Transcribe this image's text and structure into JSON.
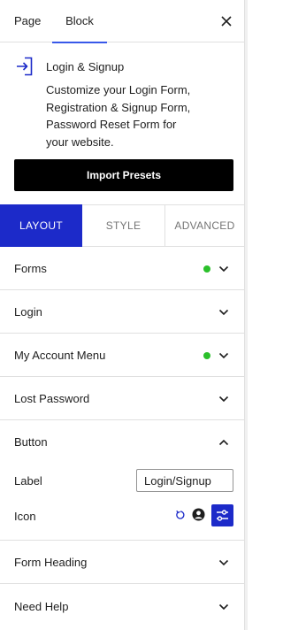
{
  "header": {
    "tabs": [
      {
        "label": "Page"
      },
      {
        "label": "Block"
      }
    ]
  },
  "block": {
    "title": "Login & Signup",
    "description": "Customize your Login Form, Registration & Signup Form, Password Reset Form for your website.",
    "import_label": "Import Presets"
  },
  "style_tabs": [
    {
      "label": "LAYOUT"
    },
    {
      "label": "STYLE"
    },
    {
      "label": "ADVANCED"
    }
  ],
  "panels": [
    {
      "label": "Forms",
      "status": "active"
    },
    {
      "label": "Login"
    },
    {
      "label": "My Account Menu",
      "status": "active"
    },
    {
      "label": "Lost Password"
    },
    {
      "label": "Button",
      "expanded": true
    },
    {
      "label": "Form Heading"
    },
    {
      "label": "Need Help"
    }
  ],
  "button_panel": {
    "label_field": {
      "label": "Label",
      "value": "Login/Signup"
    },
    "icon_field": {
      "label": "Icon"
    }
  },
  "colors": {
    "accent": "#1c2ac9",
    "tab_underline": "#3858e9",
    "status_dot": "#2bc02b"
  }
}
